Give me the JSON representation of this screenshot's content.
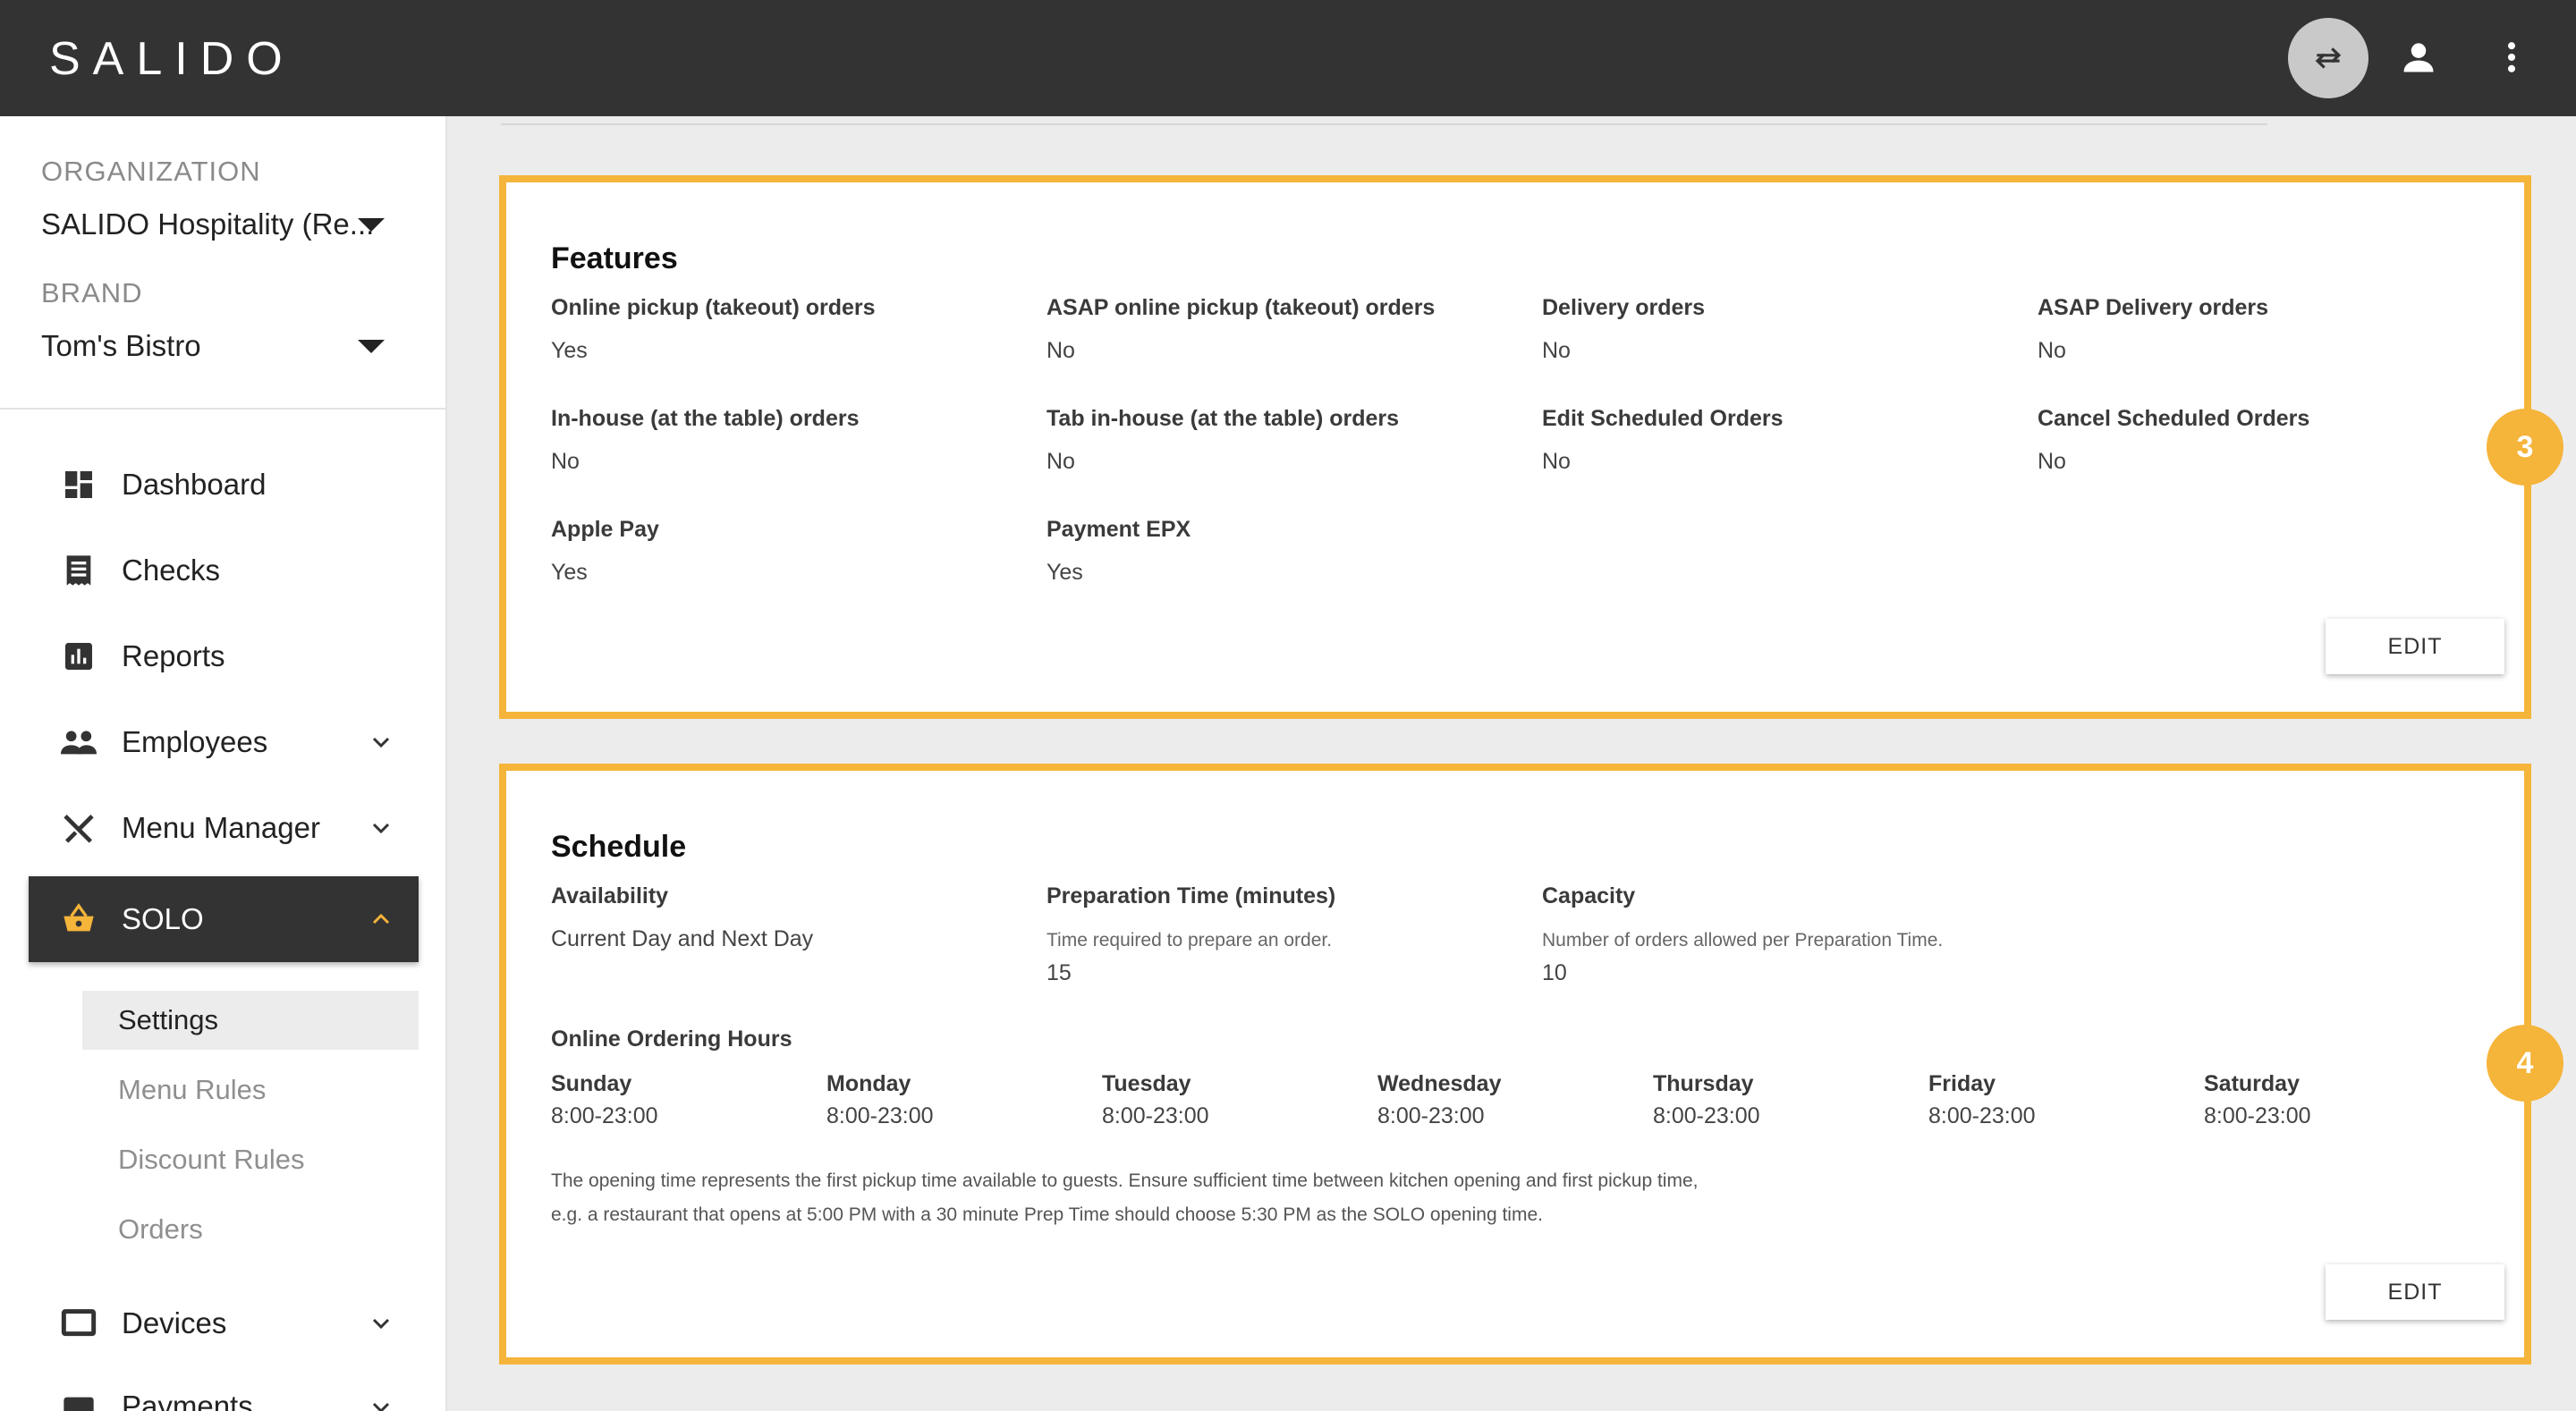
{
  "app": {
    "brand_logo": "SALIDO"
  },
  "topbar": {
    "switch_icon": "swap-icon",
    "user_icon": "account-icon",
    "menu_icon": "more-vert-icon"
  },
  "sidebar": {
    "org_label": "ORGANIZATION",
    "org_value": "SALIDO Hospitality (Re...",
    "brand_label": "BRAND",
    "brand_value": "Tom's Bistro",
    "nav": [
      {
        "label": "Dashboard",
        "icon": "dashboard-icon"
      },
      {
        "label": "Checks",
        "icon": "receipt-icon"
      },
      {
        "label": "Reports",
        "icon": "bar-chart-icon"
      },
      {
        "label": "Employees",
        "icon": "people-icon"
      },
      {
        "label": "Menu Manager",
        "icon": "utensils-icon"
      },
      {
        "label": "SOLO",
        "icon": "basket-icon"
      },
      {
        "label": "Devices",
        "icon": "monitor-icon"
      },
      {
        "label": "Payments",
        "icon": "card-icon"
      }
    ],
    "solo_sub": [
      "Settings",
      "Menu Rules",
      "Discount Rules",
      "Orders"
    ]
  },
  "features": {
    "title": "Features",
    "fields": [
      {
        "label": "Online pickup (takeout) orders",
        "value": "Yes"
      },
      {
        "label": "ASAP online pickup (takeout) orders",
        "value": "No"
      },
      {
        "label": "Delivery orders",
        "value": "No"
      },
      {
        "label": "ASAP Delivery orders",
        "value": "No"
      },
      {
        "label": "In-house (at the table) orders",
        "value": "No"
      },
      {
        "label": "Tab in-house (at the table) orders",
        "value": "No"
      },
      {
        "label": "Edit Scheduled Orders",
        "value": "No"
      },
      {
        "label": "Cancel Scheduled Orders",
        "value": "No"
      },
      {
        "label": "Apple Pay",
        "value": "Yes"
      },
      {
        "label": "Payment EPX",
        "value": "Yes"
      }
    ],
    "edit_label": "EDIT",
    "badge": "3"
  },
  "schedule": {
    "title": "Schedule",
    "availability_label": "Availability",
    "availability_value": "Current Day and Next Day",
    "prep_label": "Preparation Time (minutes)",
    "prep_hint": "Time required to prepare an order.",
    "prep_value": "15",
    "capacity_label": "Capacity",
    "capacity_hint": "Number of orders allowed per Preparation Time.",
    "capacity_value": "10",
    "hours_label": "Online Ordering Hours",
    "days": [
      {
        "day": "Sunday",
        "hours": "8:00-23:00"
      },
      {
        "day": "Monday",
        "hours": "8:00-23:00"
      },
      {
        "day": "Tuesday",
        "hours": "8:00-23:00"
      },
      {
        "day": "Wednesday",
        "hours": "8:00-23:00"
      },
      {
        "day": "Thursday",
        "hours": "8:00-23:00"
      },
      {
        "day": "Friday",
        "hours": "8:00-23:00"
      },
      {
        "day": "Saturday",
        "hours": "8:00-23:00"
      }
    ],
    "note_line1": "The opening time represents the first pickup time available to guests. Ensure sufficient time between kitchen opening and first pickup time,",
    "note_line2": "e.g. a restaurant that opens at 5:00 PM with a 30 minute Prep Time should choose 5:30 PM as the SOLO opening time.",
    "edit_label": "EDIT",
    "badge": "4"
  },
  "colors": {
    "accent": "#f5b43a",
    "topbar": "#333333",
    "active_nav": "#333333"
  }
}
